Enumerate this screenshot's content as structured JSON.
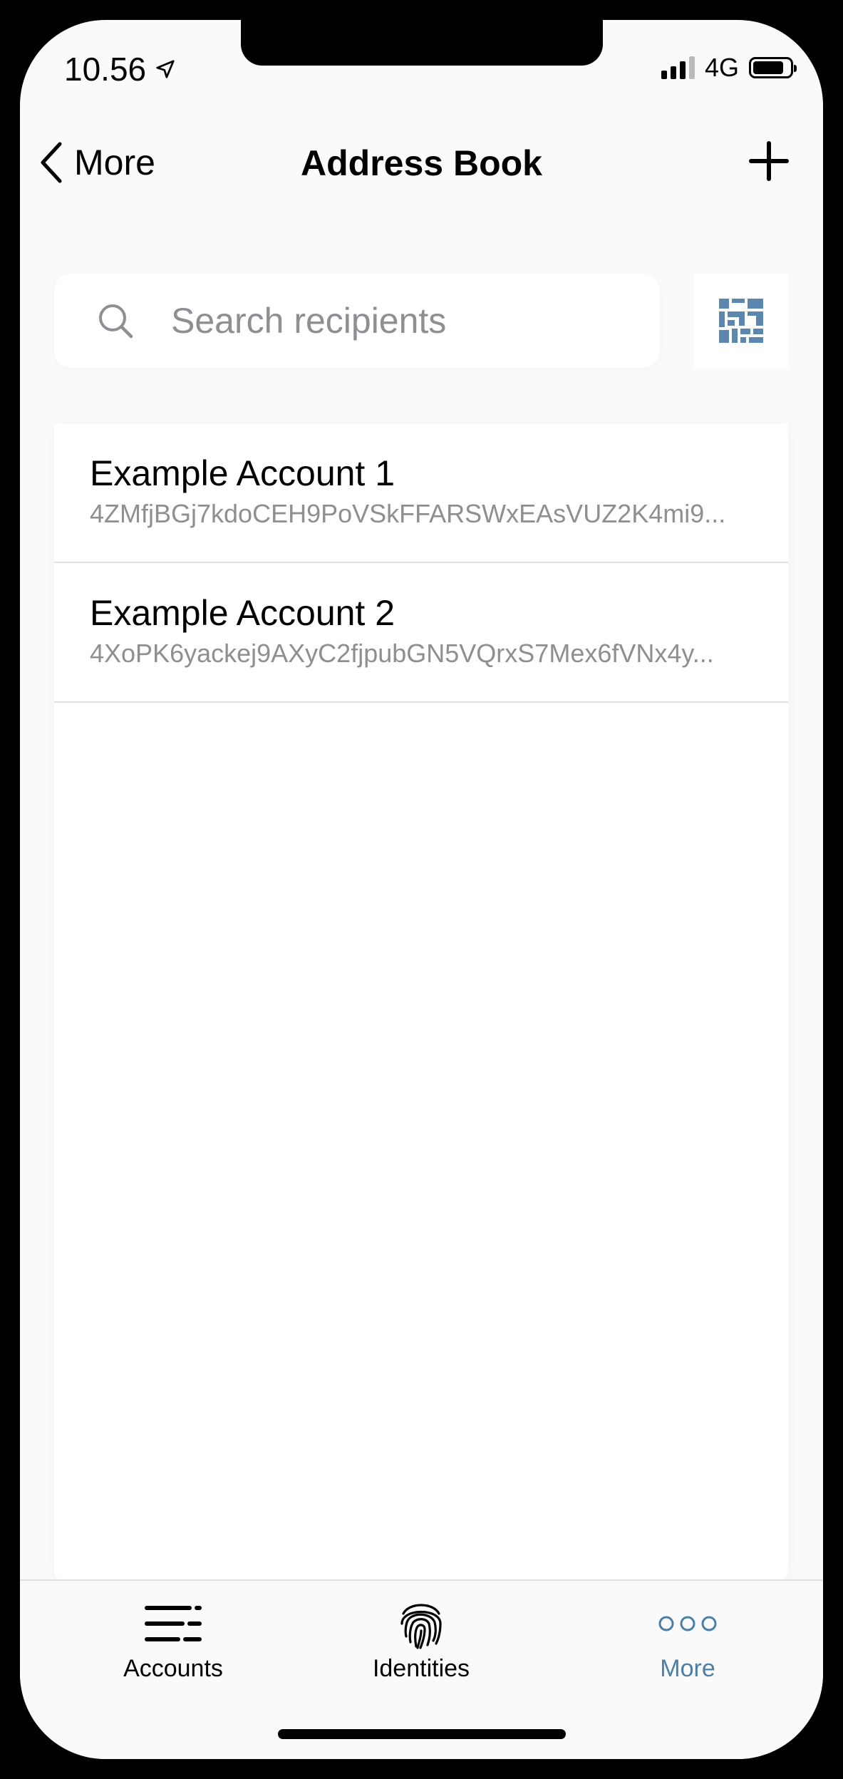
{
  "status_bar": {
    "time": "10.56",
    "network": "4G"
  },
  "nav": {
    "back_label": "More",
    "title": "Address Book"
  },
  "search": {
    "placeholder": "Search recipients"
  },
  "recipients": [
    {
      "name": "Example Account 1",
      "address": "4ZMfjBGj7kdoCEH9PoVSkFFARSWxEAsVUZ2K4mi9..."
    },
    {
      "name": "Example Account 2",
      "address": "4XoPK6yackej9AXyC2fjpubGN5VQrxS7Mex6fVNx4y..."
    }
  ],
  "tabs": [
    {
      "label": "Accounts",
      "icon": "accounts-list-icon"
    },
    {
      "label": "Identities",
      "icon": "fingerprint-icon"
    },
    {
      "label": "More",
      "icon": "more-dots-icon",
      "active": true
    }
  ],
  "colors": {
    "accent": "#4a7fa8",
    "qr_icon": "#5b86ad"
  }
}
